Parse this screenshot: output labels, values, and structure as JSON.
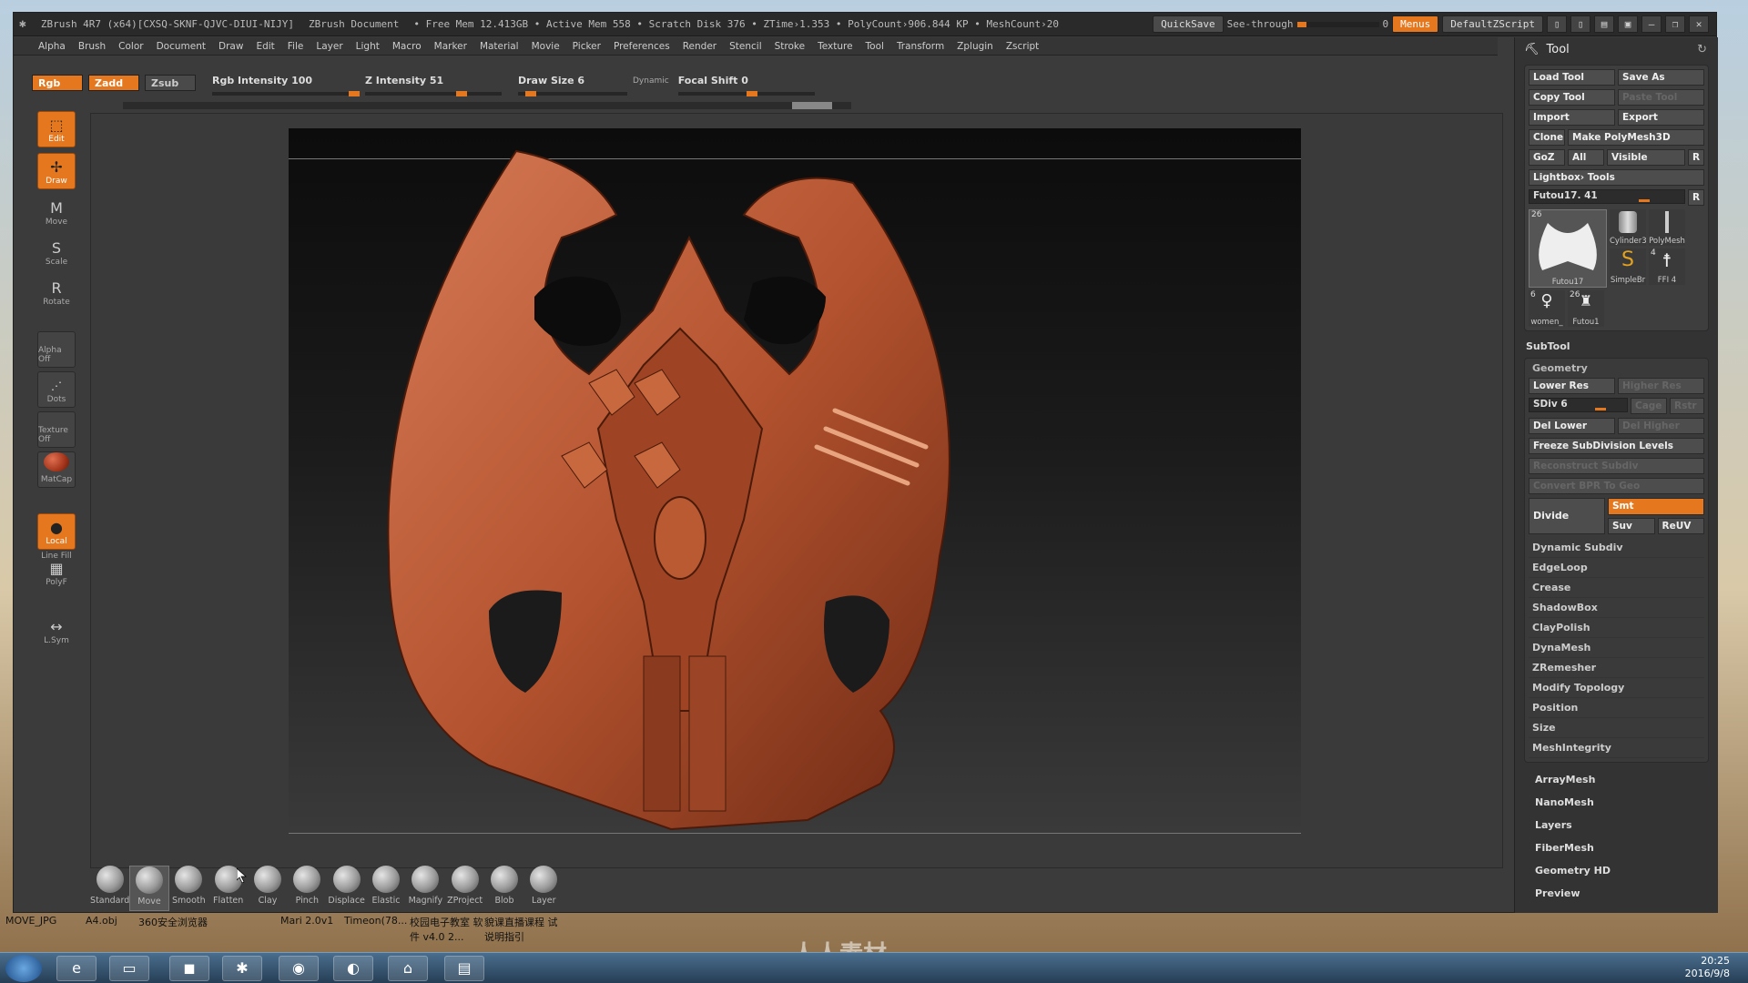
{
  "window": {
    "title": "ZBrush 4R7 (x64)[CXSQ-SKNF-QJVC-DIUI-NIJY]",
    "doc": "ZBrush Document",
    "stats": "• Free Mem 12.413GB • Active Mem 558 • Scratch Disk 376 • ZTime›1.353 • PolyCount›906.844 KP • MeshCount›20"
  },
  "topright": {
    "quicksave": "QuickSave",
    "see_through": "See-through",
    "see_through_value": "0",
    "menus": "Menus",
    "script": "DefaultZScript"
  },
  "menus": [
    "Alpha",
    "Brush",
    "Color",
    "Document",
    "Draw",
    "Edit",
    "File",
    "Layer",
    "Light",
    "Macro",
    "Marker",
    "Material",
    "Movie",
    "Picker",
    "Preferences",
    "Render",
    "Stencil",
    "Stroke",
    "Texture",
    "Tool",
    "Transform",
    "Zplugin",
    "Zscript"
  ],
  "brushbar": {
    "rgb": "Rgb",
    "zadd": "Zadd",
    "zsub": "Zsub",
    "rgb_intensity": "Rgb  Intensity 100",
    "z_intensity": "Z  Intensity 51",
    "draw_size": "Draw  Size 6",
    "dynamic": "Dynamic",
    "focal_shift": "Focal  Shift 0"
  },
  "leftshelf": {
    "edit": "Edit",
    "draw": "Draw",
    "move": "Move",
    "scale": "Scale",
    "rotate": "Rotate",
    "alpha": "Alpha Off",
    "dots": "Dots",
    "texture": "Texture Off",
    "matcap": "MatCap",
    "local": "Local",
    "linefill": "Line Fill",
    "polyf": "PolyF",
    "lsym": "L.Sym"
  },
  "brushes": [
    "Standard",
    "Move",
    "Smooth",
    "Flatten",
    "Clay",
    "Pinch",
    "Displace",
    "Elastic",
    "Magnify",
    "ZProject",
    "Blob",
    "Layer"
  ],
  "tool_panel": {
    "title": "Tool",
    "load_tool": "Load Tool",
    "save_as": "Save As",
    "copy_tool": "Copy Tool",
    "paste_tool": "Paste Tool",
    "import": "Import",
    "export": "Export",
    "clone": "Clone",
    "make_polymesh": "Make PolyMesh3D",
    "goz": "GoZ",
    "all": "All",
    "visible": "Visible",
    "r": "R",
    "lightbox_tools": "Lightbox› Tools",
    "current_tool": "Futou17. 41",
    "thumbs": [
      {
        "count": "26",
        "label": "Futou17"
      },
      {
        "count": "",
        "label": "Cylinder3"
      },
      {
        "count": "",
        "label": "PolyMesh"
      },
      {
        "count": "",
        "label": "SimpleBr"
      },
      {
        "count": "4",
        "label": "FFI 4"
      },
      {
        "count": "6",
        "label": "women_"
      },
      {
        "count": "26",
        "label": "Futou1"
      }
    ],
    "subtool": "SubTool",
    "geometry": "Geometry",
    "lower_res": "Lower Res",
    "higher_res": "Higher Res",
    "sdiv": "SDiv 6",
    "cage": "Cage",
    "rstr": "Rstr",
    "del_lower": "Del Lower",
    "del_higher": "Del Higher",
    "freeze": "Freeze SubDivision Levels",
    "reconstruct": "Reconstruct Subdiv",
    "convert_bpr": "Convert BPR To Geo",
    "divide": "Divide",
    "smt": "Smt",
    "suv": "Suv",
    "reuv": "ReUV",
    "geo_items": [
      "Dynamic Subdiv",
      "EdgeLoop",
      "Crease",
      "ShadowBox",
      "ClayPolish",
      "DynaMesh",
      "ZRemesher",
      "Modify Topology",
      "Position",
      "Size",
      "MeshIntegrity"
    ],
    "sub_items": [
      "ArrayMesh",
      "NanoMesh",
      "Layers",
      "FiberMesh",
      "Geometry HD",
      "Preview"
    ]
  },
  "desktop": {
    "labels": [
      "MOVE_JPG",
      "A4.obj",
      "360安全浏览器",
      "Mari 2.0v1",
      "Timeon(78...",
      "校园电子教室 软件 v4.0 2...",
      "貌课直播课程 试说明指引"
    ],
    "watermark": "人人素材"
  },
  "taskbar": {
    "time": "20:25",
    "date": "2016/9/8"
  },
  "colors": {
    "accent": "#e5781e",
    "clay": "#b4532f"
  }
}
